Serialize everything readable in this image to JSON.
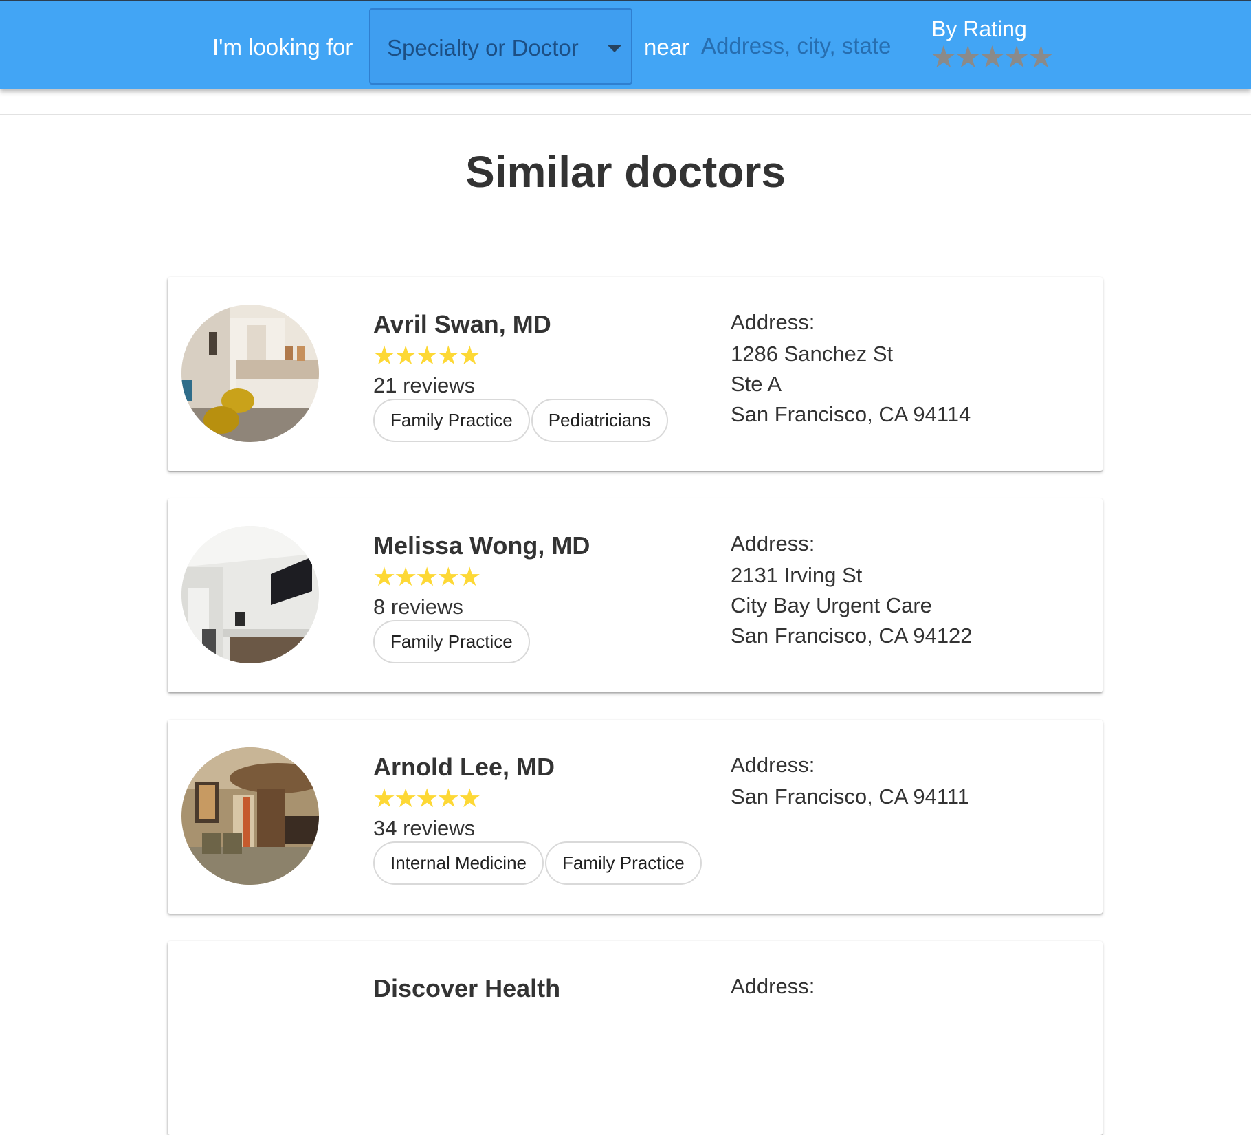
{
  "header": {
    "looking_for_label": "I'm looking for",
    "specialty_select_value": "Specialty or Doctor",
    "near_label": "near",
    "address_placeholder": "Address, city, state",
    "by_rating_label": "By Rating",
    "rating_stars": "★★★★★",
    "rating_value": 0,
    "colors": {
      "bar": "#42a5f5",
      "star_inactive": "#8a8a8a"
    }
  },
  "main": {
    "title": "Similar doctors",
    "address_label": "Address:",
    "doctors": [
      {
        "name": "Avril Swan, MD",
        "stars": "★★★★★",
        "rating": 5,
        "reviews": "21 reviews",
        "specialties": [
          "Family Practice",
          "Pediatricians"
        ],
        "address_lines": [
          "1286 Sanchez St",
          "Ste A",
          "San Francisco, CA 94114"
        ],
        "photo_icon": "clinic-waiting-room-photo"
      },
      {
        "name": "Melissa Wong, MD",
        "stars": "★★★★★",
        "rating": 5,
        "reviews": "8 reviews",
        "specialties": [
          "Family Practice"
        ],
        "address_lines": [
          "2131 Irving St",
          "City Bay Urgent Care",
          "San Francisco, CA 94122"
        ],
        "photo_icon": "clinic-hallway-photo"
      },
      {
        "name": "Arnold Lee, MD",
        "stars": "★★★★★",
        "rating": 5,
        "reviews": "34 reviews",
        "specialties": [
          "Internal Medicine",
          "Family Practice"
        ],
        "address_lines": [
          "San Francisco, CA 94111"
        ],
        "photo_icon": "clinic-lobby-photo"
      },
      {
        "name": "Discover Health",
        "stars": "",
        "reviews": "",
        "specialties": [],
        "address_lines": [],
        "photo_icon": ""
      }
    ],
    "colors": {
      "star_active": "#fdd835"
    }
  }
}
